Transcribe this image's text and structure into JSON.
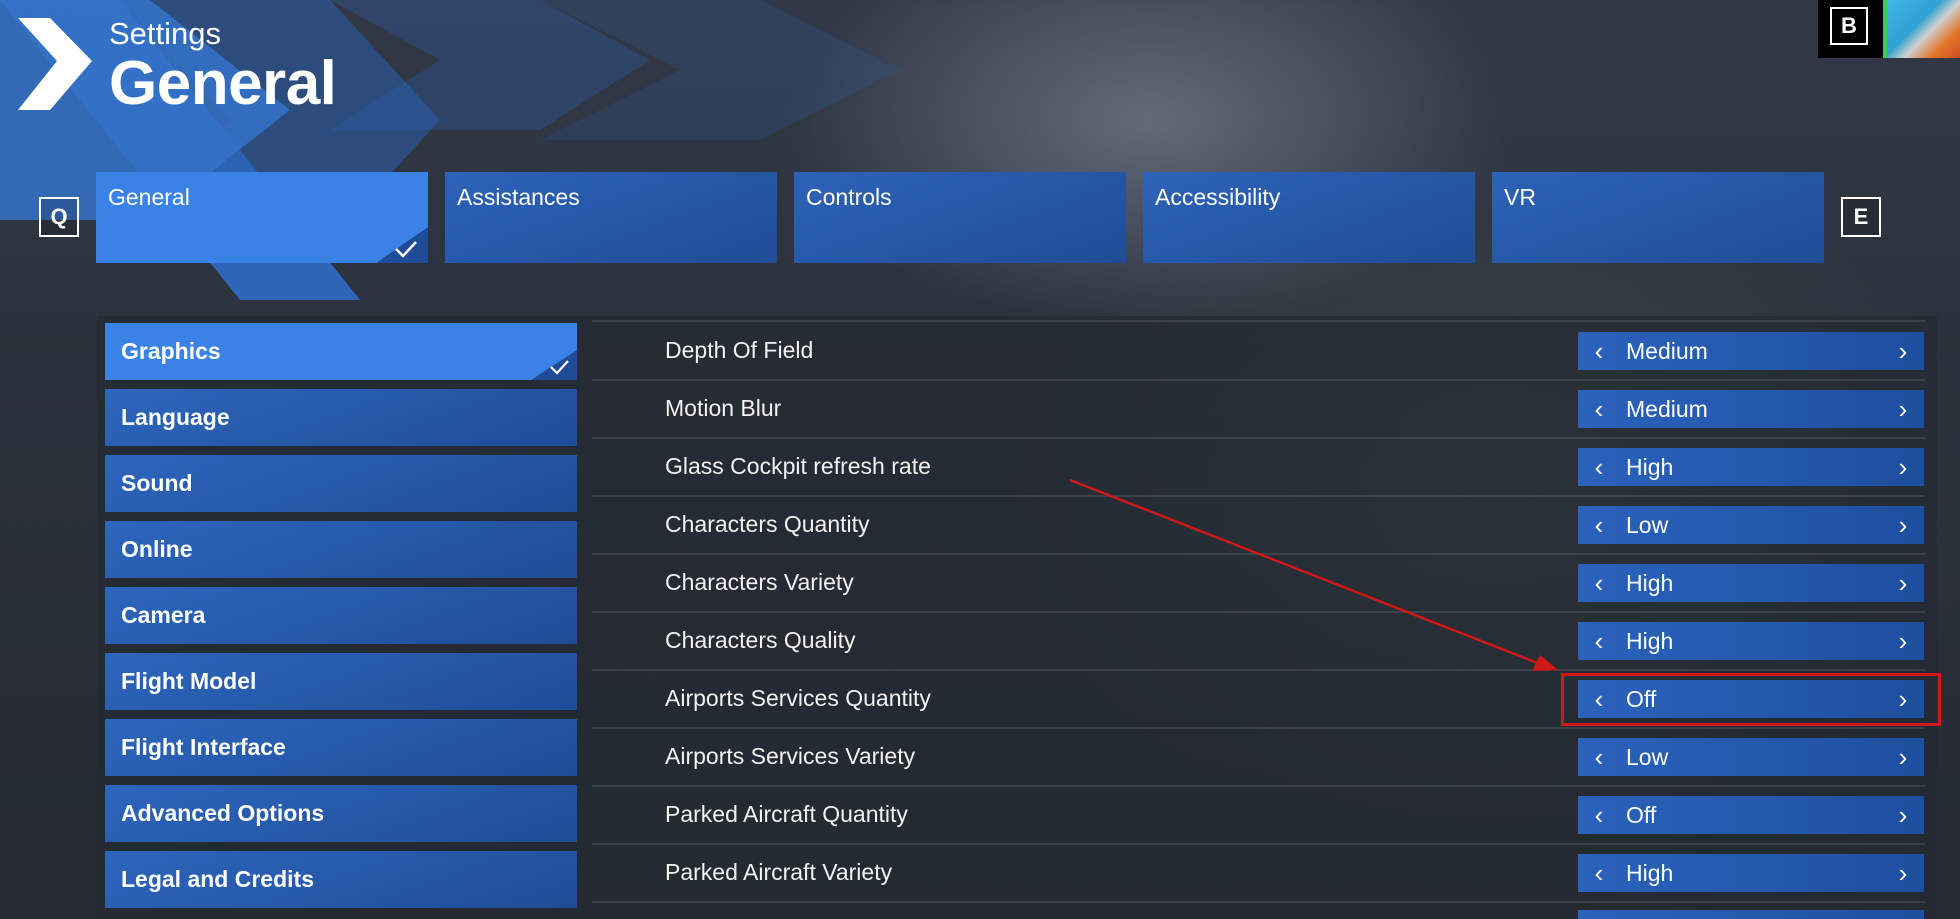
{
  "header": {
    "subtitle": "Settings",
    "title": "General",
    "back_key": "B"
  },
  "tabs": {
    "prev_key": "Q",
    "next_key": "E",
    "items": [
      {
        "label": "General",
        "active": true
      },
      {
        "label": "Assistances",
        "active": false
      },
      {
        "label": "Controls",
        "active": false
      },
      {
        "label": "Accessibility",
        "active": false
      },
      {
        "label": "VR",
        "active": false
      }
    ]
  },
  "sidebar": {
    "items": [
      {
        "label": "Graphics",
        "active": true
      },
      {
        "label": "Language"
      },
      {
        "label": "Sound"
      },
      {
        "label": "Online"
      },
      {
        "label": "Camera"
      },
      {
        "label": "Flight Model"
      },
      {
        "label": "Flight Interface"
      },
      {
        "label": "Advanced Options"
      },
      {
        "label": "Legal and Credits"
      }
    ]
  },
  "settings": {
    "rows": [
      {
        "label": "Depth Of Field",
        "value": "Medium"
      },
      {
        "label": "Motion Blur",
        "value": "Medium"
      },
      {
        "label": "Glass Cockpit refresh rate",
        "value": "High"
      },
      {
        "label": "Characters Quantity",
        "value": "Low"
      },
      {
        "label": "Characters Variety",
        "value": "High"
      },
      {
        "label": "Characters Quality",
        "value": "High"
      },
      {
        "label": "Airports Services Quantity",
        "value": "Off",
        "highlighted": true
      },
      {
        "label": "Airports Services Variety",
        "value": "Low"
      },
      {
        "label": "Parked Aircraft Quantity",
        "value": "Off"
      },
      {
        "label": "Parked Aircraft Variety",
        "value": "High"
      }
    ]
  },
  "icons": {
    "selector_left": "chevron-left-icon",
    "selector_right": "chevron-right-icon",
    "active_check": "checkmark-icon"
  },
  "colors": {
    "accent_active": "#3a82e6",
    "tab_bg": "#1f4c97",
    "annotation_red": "#d01818"
  }
}
